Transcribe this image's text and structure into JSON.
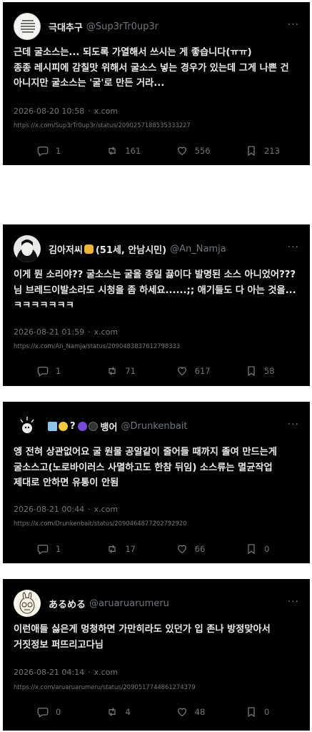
{
  "posts": [
    {
      "name": "극대추구",
      "handle": "@Sup3rTr0up3r",
      "text": "근데 굴소스는... 되도록 가열해서 쓰시는 게 좋습니다(ㅠㅠ)\n종종 레시피에 감칠맛 위해서 굴소스 넣는 경우가 있는데 그게 나쁜 건 아니지만 굴소스는 '굴'로 만든 거라...",
      "time": "2026-08-20 10:58",
      "source": "x.com",
      "url": "https://x.com/Sup3rTr0up3r/status/2090257188535333227",
      "replies": "1",
      "reposts": "161",
      "likes": "556",
      "bookmarks": "213"
    },
    {
      "name": "김아저씨",
      "name_suffix": "(51세, 안남시민)",
      "handle": "@An_Namja",
      "text": "이게 뭔 소리야?? 굴소스는 굴을 종일 끓이다 발명된 소스 아니었어??? 님 브레드이발소라도 시청을 좀 하세요......;; 애기들도 다 아는 것을...ㅋㅋㅋㅋㅋㅋㅋ",
      "time": "2026-08-21 01:59",
      "source": "x.com",
      "url": "https://x.com/An_Namja/status/2090483837612798333",
      "replies": "1",
      "reposts": "71",
      "likes": "617",
      "bookmarks": "58"
    },
    {
      "name": "뱅어",
      "name_prefix": "?",
      "handle": "@Drunkenbait",
      "text": "엥 전혀 상관없어요 굴 원물 공알같이 줄어들 때까지 졸여 만드는게 굴소스고(노로바이러스 사멸하고도 한참 뒤임) 소스류는 멸균작업 제대로 안하면 유통이 안됨",
      "time": "2026-08-21 00:44",
      "source": "x.com",
      "url": "https://x.com/Drunkenbait/status/2090464877202792920",
      "replies": "1",
      "reposts": "17",
      "likes": "66",
      "bookmarks": "0"
    },
    {
      "name": "あるめる",
      "handle": "@aruaruarumeru",
      "text": "이런애들 싫은게 멍청하면 가만히라도 있던가 입 존나 방정맞아서 거짓정보 퍼뜨리고다님",
      "time": "2026-08-21 04:14",
      "source": "x.com",
      "url": "https://x.com/aruaruarumeru/status/2090517744861274379",
      "replies": "0",
      "reposts": "4",
      "likes": "48",
      "bookmarks": "0"
    }
  ],
  "more_icon": "···",
  "icons": [
    "reply-icon",
    "repost-icon",
    "like-icon",
    "bookmark-icon"
  ]
}
